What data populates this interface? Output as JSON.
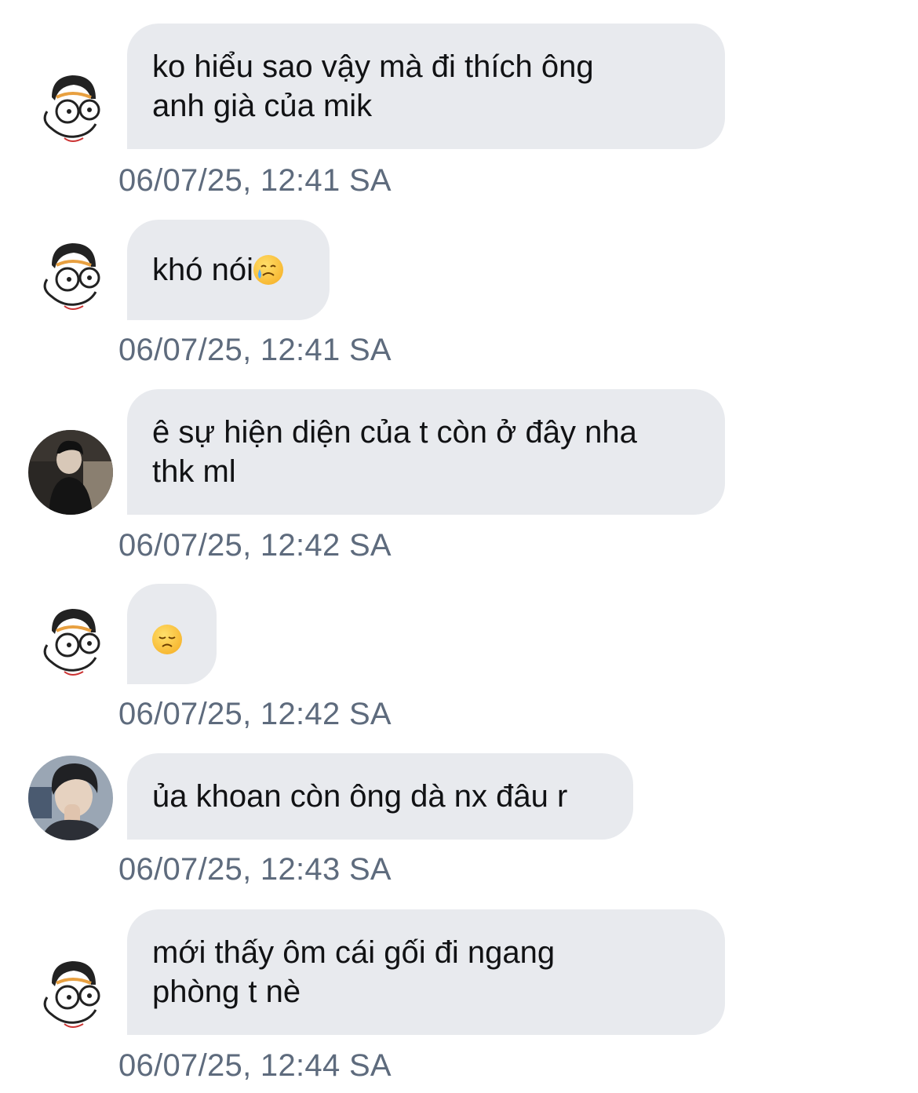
{
  "messages": [
    {
      "sender": "cartoon",
      "text": "ko hiểu sao vậy mà đi thích ông\nanh già của mik",
      "time": "06/07/25, 12:41 SA"
    },
    {
      "sender": "cartoon",
      "text": "khó nói",
      "emoji": "crying-smile-emoji",
      "time": "06/07/25, 12:41 SA"
    },
    {
      "sender": "photo-dark",
      "text": "ê sự hiện diện của t còn ở đây nha\nthk ml",
      "time": "06/07/25, 12:42 SA"
    },
    {
      "sender": "cartoon",
      "text": "",
      "emoji": "disappointed-face-emoji",
      "time": "06/07/25, 12:42 SA"
    },
    {
      "sender": "photo-person",
      "text": "ủa khoan còn ông dà nx đâu r",
      "time": "06/07/25, 12:43 SA"
    },
    {
      "sender": "cartoon",
      "text": "mới thấy ôm cái gối đi ngang\nphòng t nè",
      "time": "06/07/25, 12:44 SA"
    }
  ],
  "colors": {
    "bubble": "#e8eaee",
    "timestamp": "#5e6b7d",
    "text": "#111214",
    "background": "#ffffff"
  }
}
